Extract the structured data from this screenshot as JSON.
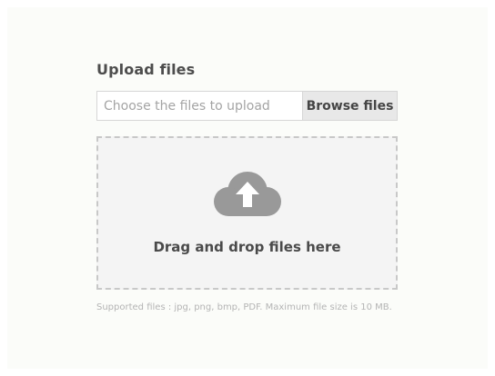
{
  "upload": {
    "heading": "Upload files",
    "input_placeholder": "Choose the files to upload",
    "browse_label": "Browse files",
    "dropzone_label": "Drag and drop files here",
    "dropzone_icon": "cloud-upload-icon",
    "help_text": "Supported files : jpg, png, bmp, PDF. Maximum file size is 10 MB."
  },
  "colors": {
    "page_background": "#fbfcf9",
    "dropzone_background": "#f4f4f4",
    "dropzone_border": "#c8c8c8",
    "icon": "#999999",
    "button_background": "#e8e8e8"
  }
}
